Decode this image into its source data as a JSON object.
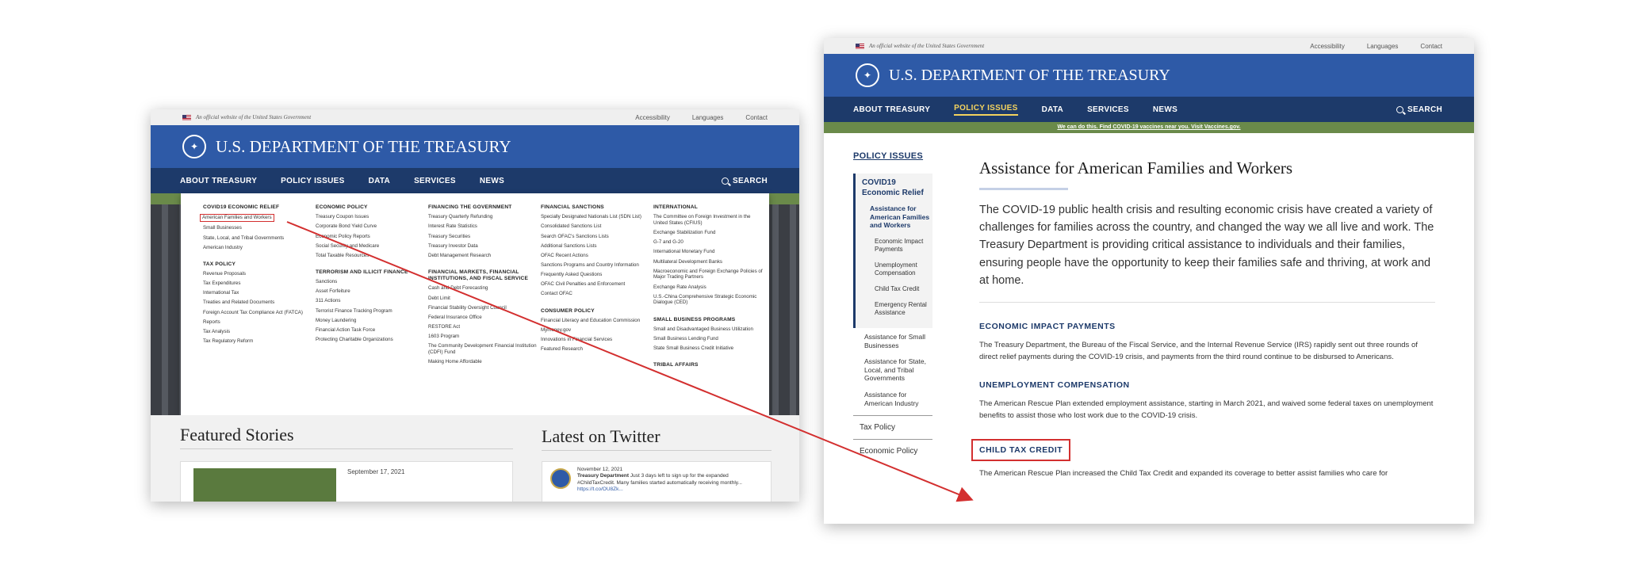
{
  "left": {
    "gov_banner": "An official website of the United States Government",
    "utility_links": [
      "Accessibility",
      "Languages",
      "Contact"
    ],
    "site_title": "U.S. DEPARTMENT OF THE TREASURY",
    "nav": [
      "ABOUT TREASURY",
      "POLICY ISSUES",
      "DATA",
      "SERVICES",
      "NEWS"
    ],
    "search_label": "SEARCH",
    "menu": [
      {
        "sections": [
          {
            "title": "COVID19 ECONOMIC RELIEF",
            "links": [
              "American Families and Workers",
              "Small Businesses",
              "State, Local, and Tribal Governments",
              "American Industry"
            ]
          },
          {
            "title": "TAX POLICY",
            "links": [
              "Revenue Proposals",
              "Tax Expenditures",
              "International Tax",
              "Treaties and Related Documents",
              "Foreign Account Tax Compliance Act (FATCA)",
              "Reports",
              "Tax Analysis",
              "Tax Regulatory Reform"
            ]
          }
        ]
      },
      {
        "sections": [
          {
            "title": "ECONOMIC POLICY",
            "links": [
              "Treasury Coupon Issues",
              "Corporate Bond Yield Curve",
              "Economic Policy Reports",
              "Social Security and Medicare",
              "Total Taxable Resources"
            ]
          },
          {
            "title": "TERRORISM AND ILLICIT FINANCE",
            "links": [
              "Sanctions",
              "Asset Forfeiture",
              "311 Actions",
              "Terrorist Finance Tracking Program",
              "Money Laundering",
              "Financial Action Task Force",
              "Protecting Charitable Organizations"
            ]
          }
        ]
      },
      {
        "sections": [
          {
            "title": "FINANCING THE GOVERNMENT",
            "links": [
              "Treasury Quarterly Refunding",
              "Interest Rate Statistics",
              "Treasury Securities",
              "Treasury Investor Data",
              "Debt Management Research"
            ]
          },
          {
            "title": "FINANCIAL MARKETS, FINANCIAL INSTITUTIONS, AND FISCAL SERVICE",
            "links": [
              "Cash and Debt Forecasting",
              "Debt Limit",
              "Financial Stability Oversight Council",
              "Federal Insurance Office",
              "RESTORE Act",
              "1603 Program",
              "The Community Development Financial Institution (CDFI) Fund",
              "Making Home Affordable"
            ]
          }
        ]
      },
      {
        "sections": [
          {
            "title": "FINANCIAL SANCTIONS",
            "links": [
              "Specially Designated Nationals List (SDN List)",
              "Consolidated Sanctions List",
              "Search OFAC's Sanctions Lists",
              "Additional Sanctions Lists",
              "OFAC Recent Actions",
              "Sanctions Programs and Country Information",
              "Frequently Asked Questions",
              "OFAC Civil Penalties and Enforcement",
              "Contact OFAC"
            ]
          },
          {
            "title": "CONSUMER POLICY",
            "links": [
              "Financial Literacy and Education Commission",
              "Mymoney.gov",
              "Innovations in Financial Services",
              "Featured Research"
            ]
          }
        ]
      },
      {
        "sections": [
          {
            "title": "INTERNATIONAL",
            "links": [
              "The Committee on Foreign Investment in the United States (CFIUS)",
              "Exchange Stabilization Fund",
              "G-7 and G-20",
              "International Monetary Fund",
              "Multilateral Development Banks",
              "Macroeconomic and Foreign Exchange Policies of Major Trading Partners",
              "Exchange Rate Analysis",
              "U.S.-China Comprehensive Strategic Economic Dialogue (CED)"
            ]
          },
          {
            "title": "SMALL BUSINESS PROGRAMS",
            "links": [
              "Small and Disadvantaged Business Utilization",
              "Small Business Lending Fund",
              "State Small Business Credit Initiative"
            ]
          },
          {
            "title": "TRIBAL AFFAIRS",
            "links": []
          }
        ]
      }
    ],
    "featured_heading": "Featured Stories",
    "featured_date": "September 17, 2021",
    "twitter_heading": "Latest on Twitter",
    "tweet": {
      "date": "November 12, 2021",
      "author": "Treasury Department",
      "text": "Just 3 days left to sign up for the expanded #ChildTaxCredit. Many families started automatically receiving monthly...",
      "link": "https://t.co/OU8Zk..."
    }
  },
  "right": {
    "gov_banner": "An official website of the United States Government",
    "utility_links": [
      "Accessibility",
      "Languages",
      "Contact"
    ],
    "site_title": "U.S. DEPARTMENT OF THE TREASURY",
    "nav": [
      "ABOUT TREASURY",
      "POLICY ISSUES",
      "DATA",
      "SERVICES",
      "NEWS"
    ],
    "active_nav": "POLICY ISSUES",
    "search_label": "SEARCH",
    "banner": "We can do this. Find COVID-19 vaccines near you. Visit Vaccines.gov.",
    "sidebar": {
      "section_title": "POLICY ISSUES",
      "current_parent": "COVID19 Economic Relief",
      "current_page": "Assistance for American Families and Workers",
      "sub_items": [
        "Economic Impact Payments",
        "Unemployment Compensation",
        "Child Tax Credit",
        "Emergency Rental Assistance"
      ],
      "siblings": [
        "Assistance for Small Businesses",
        "Assistance for State, Local, and Tribal Governments",
        "Assistance for American Industry"
      ],
      "top_items": [
        "Tax Policy",
        "Economic Policy"
      ]
    },
    "page_title": "Assistance for American Families and Workers",
    "lead": "The COVID-19 public health crisis and resulting economic crisis have created a variety of challenges for families across the country, and changed the way we all live and work. The Treasury Department is providing critical assistance to individuals and their families, ensuring people have the opportunity to keep their families safe and thriving, at work and at home.",
    "sections": [
      {
        "heading": "ECONOMIC IMPACT PAYMENTS",
        "body": "The Treasury Department, the Bureau of the Fiscal Service, and the Internal Revenue Service (IRS) rapidly sent out three rounds of direct relief payments during the COVID-19 crisis, and payments from the third round continue to be disbursed to Americans."
      },
      {
        "heading": "UNEMPLOYMENT COMPENSATION",
        "body": "The American Rescue Plan extended employment assistance, starting in March 2021, and waived some federal taxes on unemployment benefits to assist those who lost work due to the COVID-19 crisis."
      },
      {
        "heading": "CHILD TAX CREDIT",
        "body": "The American Rescue Plan increased the Child Tax Credit and expanded its coverage to better assist families who care for"
      }
    ]
  },
  "colors": {
    "brand_blue": "#2e5aa7",
    "nav_navy": "#1d3a6a",
    "banner_green": "#6a8a4a",
    "highlight_red": "#d32f2f",
    "active_yellow": "#f4d35e"
  }
}
